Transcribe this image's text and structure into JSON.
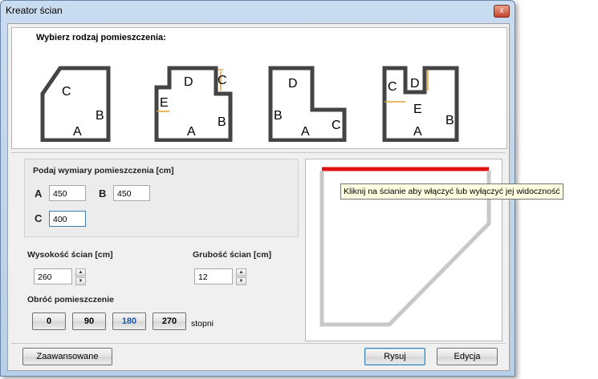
{
  "window": {
    "title": "Kreator ścian",
    "close_label": "x"
  },
  "rooms": {
    "title": "Wybierz rodzaj pomieszczenia:",
    "shapes": [
      {
        "labels": [
          "A",
          "B",
          "C"
        ]
      },
      {
        "labels": [
          "A",
          "B",
          "C",
          "D",
          "E"
        ]
      },
      {
        "labels": [
          "A",
          "B",
          "C",
          "D"
        ]
      },
      {
        "labels": [
          "A",
          "B",
          "C",
          "D",
          "E"
        ]
      }
    ]
  },
  "dimensions": {
    "title": "Podaj wymiary pomieszczenia [cm]",
    "a_label": "A",
    "a_value": "450",
    "b_label": "B",
    "b_value": "450",
    "c_label": "C",
    "c_value": "400"
  },
  "wall_height": {
    "label": "Wysokość ścian [cm]",
    "value": "260"
  },
  "wall_thickness": {
    "label": "Grubość ścian [cm]",
    "value": "12"
  },
  "rotate": {
    "label": "Obróć pomieszczenie",
    "options": [
      "0",
      "90",
      "180",
      "270"
    ],
    "selected": "180",
    "unit": "stopni"
  },
  "preview": {
    "tooltip": "Kliknij na ścianie aby włączyć lub wyłączyć jej widoczność"
  },
  "buttons": {
    "advanced": "Zaawansowane",
    "draw": "Rysuj",
    "edit": "Edycja"
  },
  "colors": {
    "highlight_wall": "#e01010",
    "wall": "#c8c8c8",
    "dimension_marker": "#e0a030"
  }
}
